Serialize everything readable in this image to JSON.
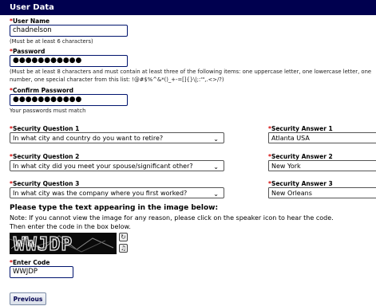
{
  "header": {
    "title": "User Data"
  },
  "username": {
    "label": "User Name",
    "value": "chadnelson",
    "hint": "(Must be at least 6 characters)"
  },
  "password": {
    "label": "Password",
    "value": "●●●●●●●●●●●",
    "hint_line1": "(Must be at least 8 characters and must contain at least three of the following items: one uppercase letter, one lowercase letter, one",
    "hint_line2": "number, one special character from this list: !@#$%^&*()_+-=[]{}\\|;:'\",.<>/?)"
  },
  "confirm_password": {
    "label": "Confirm Password",
    "value": "●●●●●●●●●●●",
    "hint": "Your passwords must match"
  },
  "security": [
    {
      "question_label": "Security Question 1",
      "question_value": "In what city and country do you want to retire?",
      "answer_label": "Security Answer 1",
      "answer_value": "Atlanta USA"
    },
    {
      "question_label": "Security Question 2",
      "question_value": "In what city did you meet your spouse/significant other?",
      "answer_label": "Security Answer 2",
      "answer_value": "New York"
    },
    {
      "question_label": "Security Question 3",
      "question_value": "In what city was the company where you first worked?",
      "answer_label": "Security Answer 3",
      "answer_value": "New Orleans"
    }
  ],
  "captcha": {
    "heading": "Please type the text appearing in the image below:",
    "note_line1": "Note: If you cannot view the image for any reason, please click on the speaker icon to hear the code.",
    "note_line2": "Then enter the code in the box below.",
    "image_text": "WWJDP",
    "code_label": "Enter Code",
    "code_value": "WWJDP"
  },
  "required_marker": "*",
  "buttons": {
    "previous": "Previous"
  },
  "icons": {
    "refresh": "refresh-icon",
    "speaker": "speaker-icon",
    "chevron": "chevron-down-icon"
  },
  "colors": {
    "header_bg": "#00004f",
    "required": "#d40000",
    "input_border": "#00146e"
  }
}
